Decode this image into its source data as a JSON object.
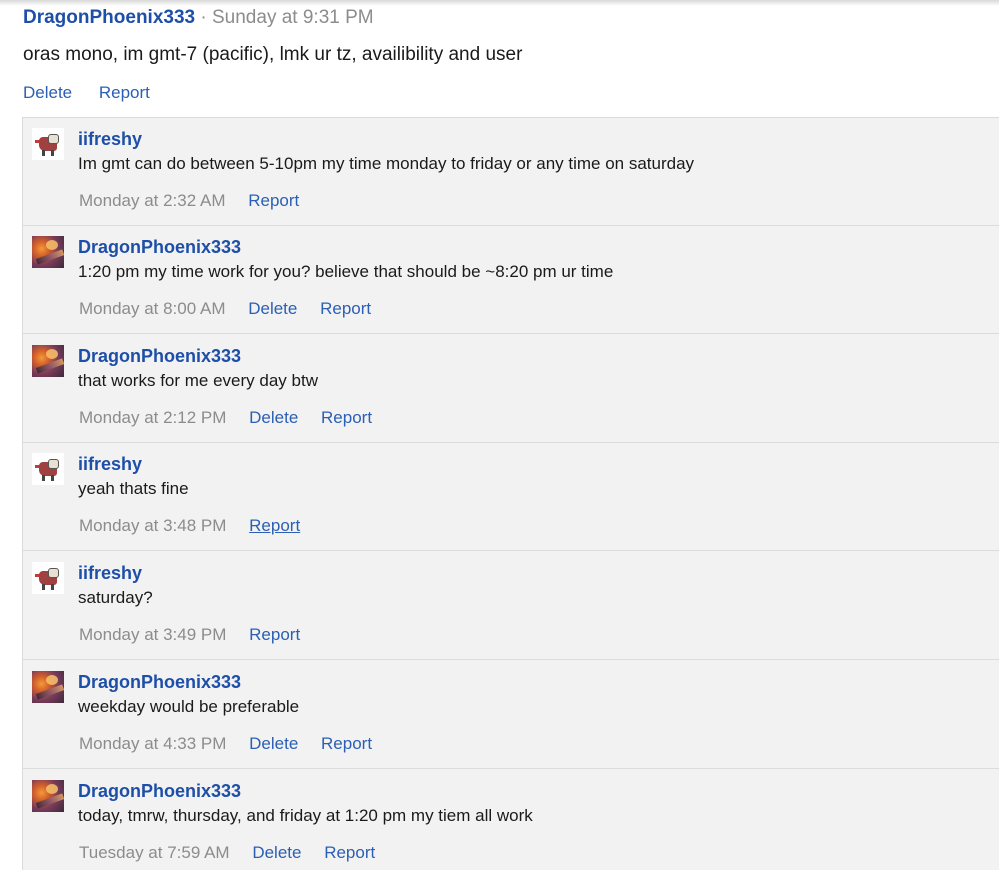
{
  "post": {
    "author": "DragonPhoenix333",
    "separator": "·",
    "time": "Sunday at 9:31 PM",
    "body": "oras mono, im gmt-7 (pacific), lmk ur tz, availibility and user",
    "actions": {
      "delete": "Delete",
      "report": "Report"
    }
  },
  "comments": [
    {
      "author": "iifreshy",
      "avatar": "sprite",
      "text": "Im gmt can do between 5-10pm my time monday to friday or any time on saturday",
      "time": "Monday at 2:32 AM",
      "delete": "",
      "report": "Report"
    },
    {
      "author": "DragonPhoenix333",
      "avatar": "photo",
      "text": "1:20 pm my time work for you? believe that should be ~8:20 pm ur time",
      "time": "Monday at 8:00 AM",
      "delete": "Delete",
      "report": "Report"
    },
    {
      "author": "DragonPhoenix333",
      "avatar": "photo",
      "text": "that works for me every day btw",
      "time": "Monday at 2:12 PM",
      "delete": "Delete",
      "report": "Report"
    },
    {
      "author": "iifreshy",
      "avatar": "sprite",
      "text": "yeah thats fine",
      "time": "Monday at 3:48 PM",
      "delete": "",
      "report": "Report"
    },
    {
      "author": "iifreshy",
      "avatar": "sprite",
      "text": "saturday?",
      "time": "Monday at 3:49 PM",
      "delete": "",
      "report": "Report"
    },
    {
      "author": "DragonPhoenix333",
      "avatar": "photo",
      "text": "weekday would be preferable",
      "time": "Monday at 4:33 PM",
      "delete": "Delete",
      "report": "Report"
    },
    {
      "author": "DragonPhoenix333",
      "avatar": "photo",
      "text": "today, tmrw, thursday, and friday at 1:20 pm my tiem all work",
      "time": "Tuesday at 7:59 AM",
      "delete": "Delete",
      "report": "Report"
    }
  ],
  "colors": {
    "link": "#2b5fb4",
    "author": "#1e4fa8",
    "muted": "#8c8c8c",
    "comment_bg": "#f2f2f2"
  }
}
